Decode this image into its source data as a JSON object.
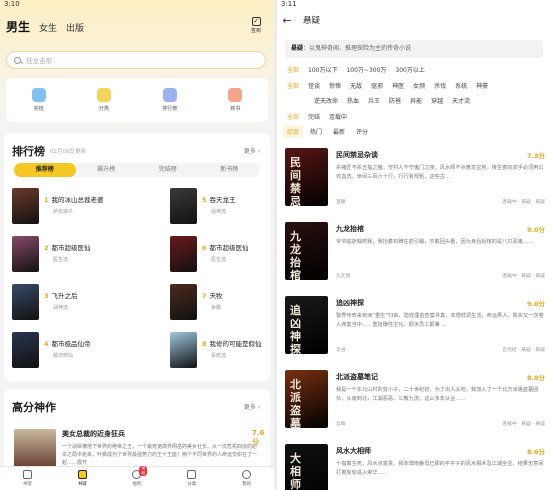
{
  "left": {
    "status_time": "3:10",
    "tabs": [
      "男生",
      "女生",
      "出版"
    ],
    "signin_label": "签到",
    "search_placeholder": "狂龙击帝",
    "quick_entries": [
      {
        "label": "完结",
        "color": "#4aa3e8"
      },
      {
        "label": "分类",
        "color": "#f2c230"
      },
      {
        "label": "排行榜",
        "color": "#6a8ee8"
      },
      {
        "label": "新书",
        "color": "#f0805e"
      }
    ],
    "ranking": {
      "title": "排行榜",
      "date": "02月09日更新",
      "more": "更多 ›",
      "tabs": [
        "推荐榜",
        "飙升榜",
        "完结榜",
        "新书榜"
      ],
      "items": [
        {
          "num": "1",
          "title": "我的冰山总裁老婆",
          "author": "护花浪子",
          "color": "#6b3a2a"
        },
        {
          "num": "2",
          "title": "都市超级医仙",
          "author": "医生流",
          "color": "#8a4a6a"
        },
        {
          "num": "3",
          "title": "飞升之后",
          "author": "战神流",
          "color": "#3a4a6a"
        },
        {
          "num": "4",
          "title": "都市极品仙帝",
          "author": "都市修仙",
          "color": "#2a3550"
        },
        {
          "num": "5",
          "title": "吞天龙王",
          "author": "战神流",
          "color": "#3a3a3a"
        },
        {
          "num": "6",
          "title": "都市超级医仙",
          "author": "医生流",
          "color": "#6a1a1a"
        },
        {
          "num": "7",
          "title": "天牧",
          "author": "争霸",
          "color": "#4a2a20"
        },
        {
          "num": "8",
          "title": "我修的可能是假仙",
          "author": "系统流",
          "color": "#9ec8e0"
        }
      ],
      "display_rows": [
        [
          "1",
          "5"
        ],
        [
          "2",
          "6"
        ],
        [
          "3",
          "7"
        ],
        [
          "4",
          "8"
        ]
      ]
    },
    "featured": {
      "title": "高分神作",
      "more": "更多 ›",
      "book_title": "美女总裁的近身狂兵",
      "score": "7.6分",
      "desc": "一个战纵横地下世界的绝世之王，一个最死诡高界阴岳的美女社长。从一次危机四伏的必杀之局中走来，叶枫成为了世界最强势力的王十王座！两个不同世界的人命运交织在了一起……展开"
    },
    "bottom_nav": [
      {
        "label": "书架",
        "active": false
      },
      {
        "label": "书城",
        "active": true
      },
      {
        "label": "福利",
        "active": false,
        "badge": "领取"
      },
      {
        "label": "分类",
        "active": false
      },
      {
        "label": "我的",
        "active": false
      }
    ]
  },
  "right": {
    "status_time": "3:11",
    "title": "悬疑",
    "tag_label": "悬疑",
    "tag_desc": "以鬼神奇闻、推理探险为主的传奇小说",
    "filters": [
      {
        "on": "全部",
        "items": [
          "100万以下",
          "100万~300万",
          "300万以上"
        ]
      },
      {
        "on": "全部",
        "items": [
          "怪谈",
          "惊悚",
          "无敌",
          "驱邪",
          "神医",
          "女频",
          "杀伐",
          "系统",
          "神豪"
        ]
      },
      {
        "on": "",
        "items": [
          "逆天改命",
          "热血",
          "兵王",
          "防爸",
          "异能",
          "穿越",
          "天才流"
        ]
      },
      {
        "on": "全部",
        "items": [
          "完结",
          "连载中"
        ]
      }
    ],
    "sort": [
      "综合",
      "热门",
      "最新",
      "评分"
    ],
    "books": [
      {
        "title": "民间禁忌杂谈",
        "score": "7.3分",
        "author": "百联",
        "tags": "连载中 · 悬疑 · 悬疑",
        "desc": "杀猪匠不杀五指之猪，守村人不守鬼门之夜。风水师不点黄龙宝地。接生婆的双手必须用公鸡血洗。世间三百六十行，行行有规矩，这些古...",
        "cover_text": "民间禁忌",
        "color": "#5a1616"
      },
      {
        "title": "九龙抬棺",
        "score": "9.0分",
        "author": "九元窗",
        "tags": "连载中 · 悬疑 · 悬疑",
        "desc": "爷爷临逝嘱咐我，我抬着石碑在前引路，不敢回头看，因为身后抬棺的是八只恶鬼……",
        "cover_text": "九龙抬棺",
        "color": "#2a1010"
      },
      {
        "title": "追凶神探",
        "score": "9.0分",
        "author": "丰谷",
        "tags": "已完结 · 悬疑 · 悬疑",
        "desc": "警界传奇来到洲“重生”归来，隐姓埋名查案寻真，本想低调生活，命运弄人，陈实又一次卷入命案当中……重拾赚性宝化。顾米员工即兼 ...",
        "cover_text": "追凶神探",
        "color": "#1a1a1a"
      },
      {
        "title": "北派盗墓笔记",
        "score": "8.8分",
        "author": "云峰",
        "tags": "连载中 · 悬疑 · 悬疑",
        "desc": "我是一个东北山村的穷小子。二十世纪初，为了出人头地，我加入了一个北方派遣盗墓团伙，从南到北，江湖恶恶，三教九流，这么多年从业……",
        "cover_text": "北派盗墓",
        "color": "#7a3010"
      },
      {
        "title": "风水大相师",
        "score": "8.6分",
        "author": "",
        "tags": "",
        "desc": "十指算生死，风水点富贵。我本博雨番母已那的平平子的风水相术及江湖全宝，结果无意间打着匆匆进入荣华……",
        "cover_text": "大相师",
        "color": "#111111"
      }
    ]
  }
}
